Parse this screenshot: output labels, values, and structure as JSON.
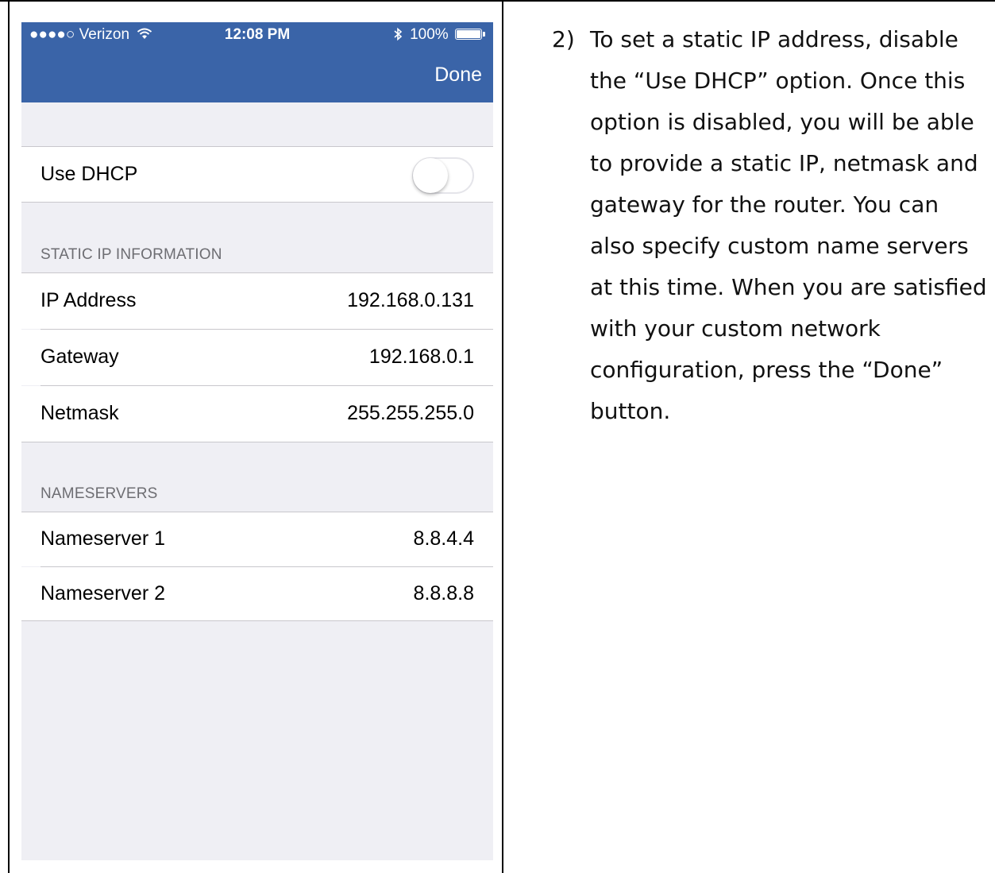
{
  "status_bar": {
    "carrier": "●●●●○ Verizon",
    "wifi_icon": "wifi-icon",
    "time": "12:08 PM",
    "bluetooth_icon": "bluetooth-icon",
    "battery": "100%"
  },
  "nav": {
    "done_label": "Done"
  },
  "dhcp": {
    "label": "Use DHCP",
    "enabled": false
  },
  "static_ip": {
    "header": "STATIC IP INFORMATION",
    "rows": [
      {
        "label": "IP Address",
        "value": "192.168.0.131"
      },
      {
        "label": "Gateway",
        "value": "192.168.0.1"
      },
      {
        "label": "Netmask",
        "value": "255.255.255.0"
      }
    ]
  },
  "nameservers": {
    "header": "NAMESERVERS",
    "rows": [
      {
        "label": "Nameserver 1",
        "value": "8.8.4.4"
      },
      {
        "label": "Nameserver 2",
        "value": "8.8.8.8"
      }
    ]
  },
  "instruction": {
    "number": "2)",
    "text": "To set a static IP address, disable the “Use DHCP” option. Once this option is disabled, you will be able to provide a static IP, netmask and gateway for the router. You can also specify custom name servers at this time. When you are satisfied with your custom network configuration, press the “Done” button."
  },
  "colors": {
    "nav_bg": "#3a64a8",
    "group_bg": "#efeff4",
    "separator": "#c8c7cc",
    "section_header": "#6d6d72"
  }
}
